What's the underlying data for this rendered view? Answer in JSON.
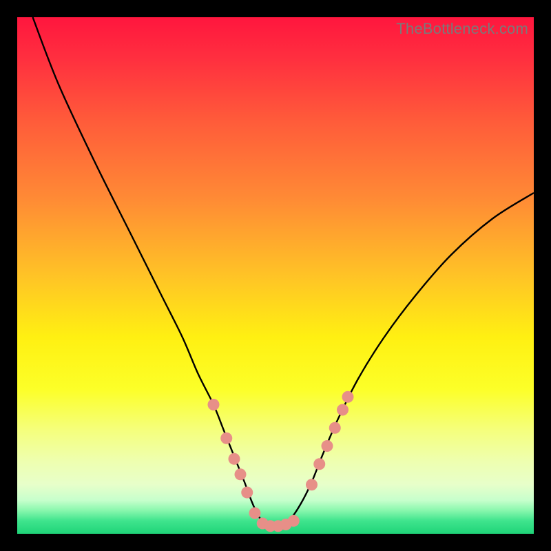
{
  "watermark": "TheBottleneck.com",
  "colors": {
    "gradient_stops": [
      {
        "offset": 0.0,
        "color": "#ff163e"
      },
      {
        "offset": 0.08,
        "color": "#ff2f3f"
      },
      {
        "offset": 0.2,
        "color": "#ff5b3a"
      },
      {
        "offset": 0.35,
        "color": "#ff8a35"
      },
      {
        "offset": 0.5,
        "color": "#ffc326"
      },
      {
        "offset": 0.62,
        "color": "#fff012"
      },
      {
        "offset": 0.72,
        "color": "#fcff28"
      },
      {
        "offset": 0.8,
        "color": "#f5ff7d"
      },
      {
        "offset": 0.86,
        "color": "#eeffb0"
      },
      {
        "offset": 0.905,
        "color": "#e7ffca"
      },
      {
        "offset": 0.935,
        "color": "#c7ffcc"
      },
      {
        "offset": 0.955,
        "color": "#88f7ad"
      },
      {
        "offset": 0.975,
        "color": "#3fe48d"
      },
      {
        "offset": 1.0,
        "color": "#1fd478"
      }
    ],
    "curve": "#000000",
    "marker_fill": "#e78f88",
    "marker_stroke": "#d96f66"
  },
  "chart_data": {
    "type": "line",
    "title": "",
    "xlabel": "",
    "ylabel": "",
    "xlim": [
      0,
      100
    ],
    "ylim": [
      0,
      100
    ],
    "series": [
      {
        "name": "bottleneck-curve",
        "x": [
          3,
          8,
          15,
          22,
          28,
          32,
          35,
          38,
          40,
          42,
          44,
          45.5,
          47,
          49,
          51,
          53,
          55,
          57,
          59,
          62,
          66,
          71,
          77,
          84,
          92,
          100
        ],
        "y": [
          100,
          87,
          72,
          58,
          46,
          38,
          31,
          25,
          20,
          15,
          10,
          6,
          3,
          1.5,
          1.5,
          3,
          6,
          10,
          15,
          22,
          30,
          38,
          46,
          54,
          61,
          66
        ]
      }
    ],
    "markers": {
      "name": "highlighted-points",
      "points": [
        {
          "x": 38.0,
          "y": 25.0
        },
        {
          "x": 40.5,
          "y": 18.5
        },
        {
          "x": 42.0,
          "y": 14.5
        },
        {
          "x": 43.2,
          "y": 11.5
        },
        {
          "x": 44.5,
          "y": 8.0
        },
        {
          "x": 46.0,
          "y": 4.0
        },
        {
          "x": 47.5,
          "y": 2.0
        },
        {
          "x": 49.0,
          "y": 1.5
        },
        {
          "x": 50.5,
          "y": 1.5
        },
        {
          "x": 52.0,
          "y": 1.8
        },
        {
          "x": 53.5,
          "y": 2.5
        },
        {
          "x": 57.0,
          "y": 9.5
        },
        {
          "x": 58.5,
          "y": 13.5
        },
        {
          "x": 60.0,
          "y": 17.0
        },
        {
          "x": 61.5,
          "y": 20.5
        },
        {
          "x": 63.0,
          "y": 24.0
        },
        {
          "x": 64.0,
          "y": 26.5
        }
      ]
    }
  }
}
